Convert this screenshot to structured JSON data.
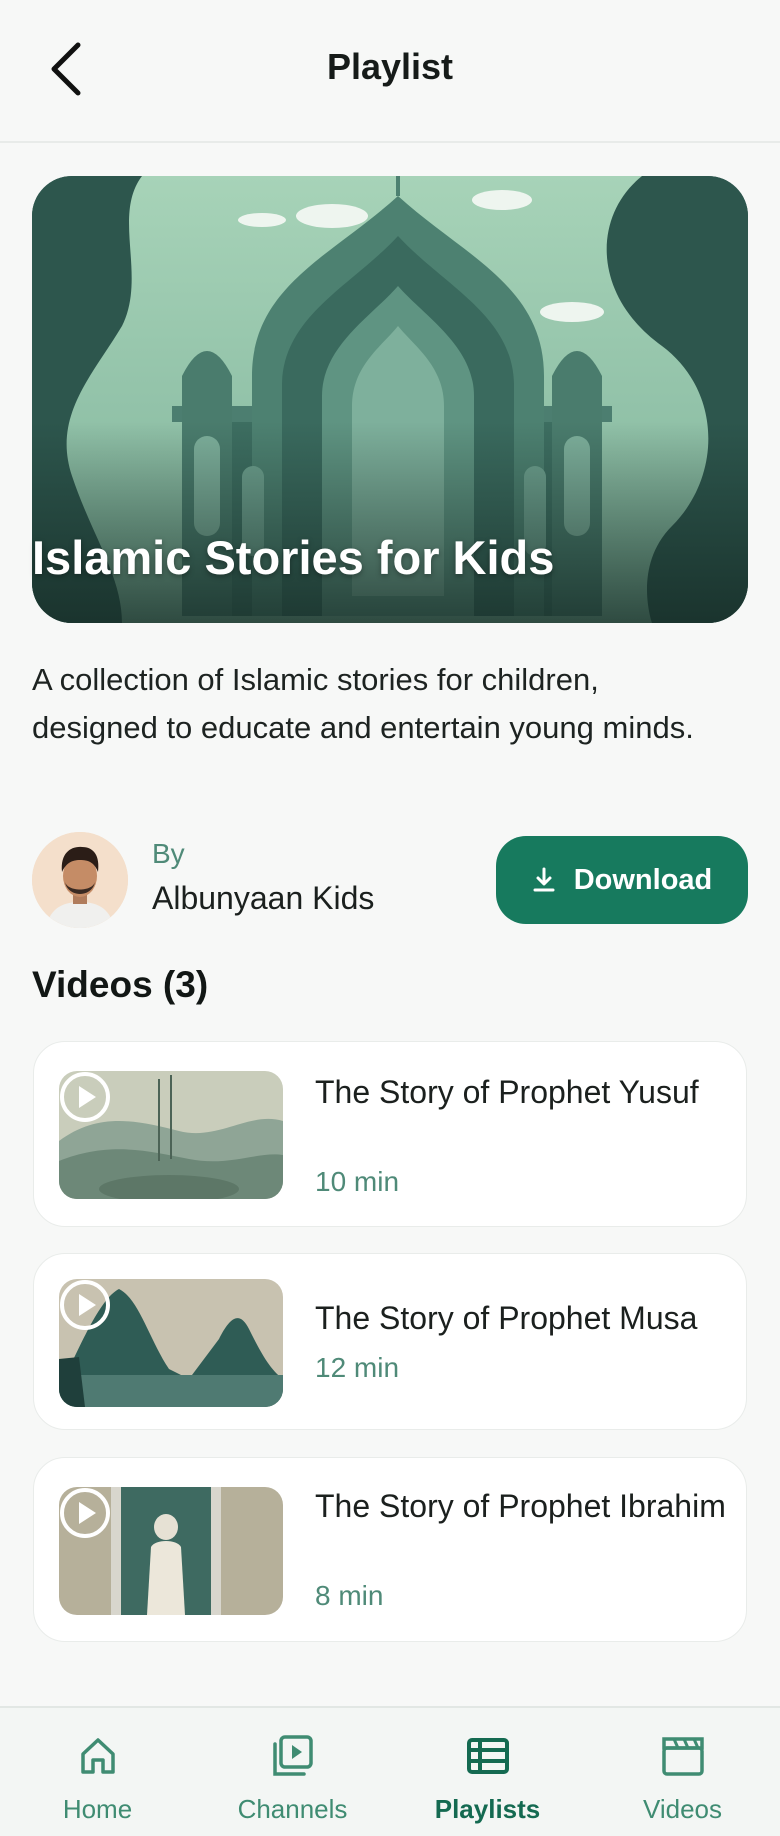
{
  "header": {
    "title": "Playlist",
    "back_icon": "chevron-left-icon"
  },
  "playlist": {
    "title": "Islamic Stories for Kids",
    "description": "A collection of Islamic stories for children, designed to educate and entertain young minds.",
    "author_prefix": "By",
    "author_name": "Albunyaan Kids",
    "download_label": "Download",
    "download_icon": "download-icon"
  },
  "videos": {
    "heading": "Videos (3)",
    "items": [
      {
        "title": "The Story of Prophet Yusuf",
        "duration": "10 min"
      },
      {
        "title": "The Story of Prophet Musa",
        "duration": "12 min"
      },
      {
        "title": "The Story of Prophet Ibrahim",
        "duration": "8 min"
      }
    ]
  },
  "nav": {
    "items": [
      {
        "label": "Home",
        "icon": "home-icon"
      },
      {
        "label": "Channels",
        "icon": "channels-icon"
      },
      {
        "label": "Playlists",
        "icon": "playlists-icon",
        "active": true
      },
      {
        "label": "Videos",
        "icon": "videos-icon"
      }
    ]
  },
  "colors": {
    "accent": "#177a5e",
    "accent_text": "#4f8a78",
    "background": "#f7f8f7"
  }
}
